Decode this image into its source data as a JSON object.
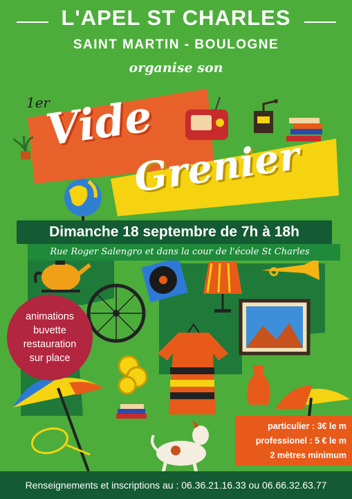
{
  "header": {
    "title": "L'APEL ST CHARLES",
    "subtitle": "SAINT MARTIN - BOULOGNE",
    "organise": "organise son"
  },
  "headline": {
    "first": "1er",
    "vide": "Vide",
    "grenier": "Grenier"
  },
  "event": {
    "date": "Dimanche 18 septembre de 7h à 18h",
    "address": "Rue Roger Salengro et dans la cour de l'école St Charles"
  },
  "services": {
    "items": [
      "animations",
      "buvette",
      "restauration",
      "sur place"
    ]
  },
  "prices": {
    "particulier": "particulier : 3€ le m",
    "professionel": "professionel : 5 € le m",
    "minimum": "2 mètres minimum"
  },
  "footer": {
    "text": "Renseignements et inscriptions au : 06.36.21.16.33 ou 06.66.32.63.77"
  },
  "colors": {
    "background": "#4cad3b",
    "dark_green": "#145a32",
    "orange": "#e85a1a",
    "yellow": "#f5d311",
    "crimson": "#b22640"
  },
  "illustrations": [
    "plant-icon",
    "radio-icon",
    "coffee-grinder-icon",
    "books-icon",
    "globe-icon",
    "teapot-icon",
    "bicycle-wheel-icon",
    "vinyl-record-icon",
    "lamp-icon",
    "trumpet-icon",
    "dress-icon",
    "painting-icon",
    "coins-icon",
    "vase-icon",
    "umbrella-icon",
    "racket-icon",
    "dog-icon"
  ]
}
